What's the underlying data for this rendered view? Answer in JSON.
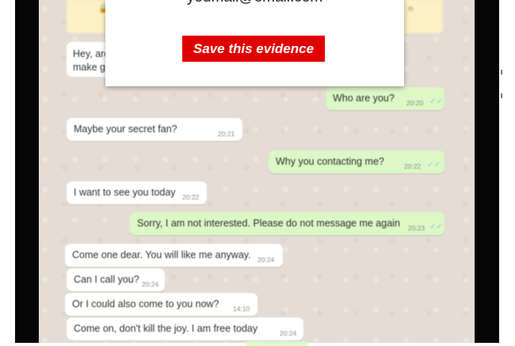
{
  "modal": {
    "email_text": "youmail@email.com",
    "save_button_label": "Save this evidence"
  },
  "banner": {
    "lock_glyph": "🔒",
    "tail_text": "n"
  },
  "partial_message": {
    "line1": "Hey, are",
    "line2": "make g"
  },
  "messages": [
    {
      "direction": "out",
      "text": "Who are you?",
      "time": "20:20",
      "ticks": "✓✓"
    },
    {
      "direction": "in",
      "text": "Maybe your secret fan?",
      "time": "20:21"
    },
    {
      "direction": "out",
      "text": "Why you contacting me?",
      "time": "20:22",
      "ticks": "✓✓"
    },
    {
      "direction": "in",
      "text": "I want to see you today",
      "time": "20:22"
    },
    {
      "direction": "out",
      "text": "Sorry, I am not interested. Please do not message me again",
      "time": "20:23",
      "ticks": "✓✓"
    },
    {
      "direction": "in",
      "text": "Come one dear. You will like me anyway.",
      "time": "20:24"
    },
    {
      "direction": "in",
      "text": "Can I call you?",
      "time": "20:24"
    },
    {
      "direction": "in",
      "text": "Or I could also come to you now?",
      "time": "14:10"
    },
    {
      "direction": "in",
      "text": "Come on, don't kill the joy. I am free today",
      "time": "20:24"
    }
  ],
  "colors": {
    "save_button": "#e10000",
    "incoming_bubble": "#ffffff",
    "outgoing_bubble": "#dcf8c6",
    "chat_background": "#e5ddd5",
    "device_frame": "#050505"
  }
}
